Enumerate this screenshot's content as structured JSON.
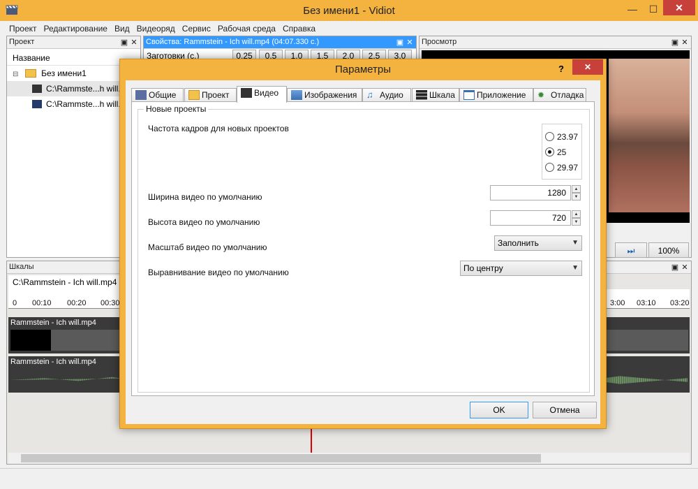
{
  "window": {
    "title": "Без имени1 - Vidiot",
    "minimize": "—",
    "maximize": "☐",
    "close": "✕"
  },
  "menu": [
    "Проект",
    "Редактирование",
    "Вид",
    "Видеоряд",
    "Сервис",
    "Рабочая среда",
    "Справка"
  ],
  "project_panel": {
    "title": "Проект",
    "column": "Название",
    "root": "Без имени1",
    "items": [
      "C:\\Rammste...h will.",
      "C:\\Rammste...h will."
    ]
  },
  "properties_panel": {
    "title": "Свойства: Rammstein - Ich will.mp4 (04:07.330 с.)",
    "presets_label": "Заготовки (с.)",
    "presets": [
      "0.25",
      "0.5",
      "1.0",
      "1.5",
      "2.0",
      "2.5",
      "3.0"
    ]
  },
  "preview_panel": {
    "title": "Просмотр",
    "zoom": "100%"
  },
  "timeline_panel": {
    "title": "Шкалы",
    "tab": "C:\\Rammstein - Ich will.mp4",
    "ticks_left": [
      "0",
      "00:10",
      "00:20",
      "00:30"
    ],
    "ticks_right": [
      "3:00",
      "03:10",
      "03:20"
    ],
    "video_clip": "Rammstein - Ich will.mp4",
    "audio_clip": "Rammstein - Ich will.mp4"
  },
  "dialog": {
    "title": "Параметры",
    "help": "?",
    "close": "✕",
    "tabs": [
      {
        "label": "Общие",
        "icon": "general-icon"
      },
      {
        "label": "Проект",
        "icon": "folder-icon"
      },
      {
        "label": "Видео",
        "icon": "clapper-icon"
      },
      {
        "label": "Изображения",
        "icon": "image-icon"
      },
      {
        "label": "Аудио",
        "icon": "music-note-icon"
      },
      {
        "label": "Шкала",
        "icon": "film-strip-icon"
      },
      {
        "label": "Приложение",
        "icon": "window-icon"
      },
      {
        "label": "Отладка",
        "icon": "bug-icon"
      }
    ],
    "selected_tab": 2,
    "group_title": "Новые проекты",
    "framerate_label": "Частота кадров для новых проектов",
    "framerate_options": [
      "23.97",
      "25",
      "29.97"
    ],
    "framerate_selected": "25",
    "width_label": "Ширина видео по умолчанию",
    "width_value": "1280",
    "height_label": "Высота видео по умолчанию",
    "height_value": "720",
    "scale_label": "Масштаб видео по умолчанию",
    "scale_value": "Заполнить",
    "align_label": "Выравнивание видео по умолчанию",
    "align_value": "По центру",
    "ok": "OK",
    "cancel": "Отмена"
  },
  "colors": {
    "accent": "#f4b23f",
    "selection": "#3399ff",
    "close": "#c7413a"
  }
}
